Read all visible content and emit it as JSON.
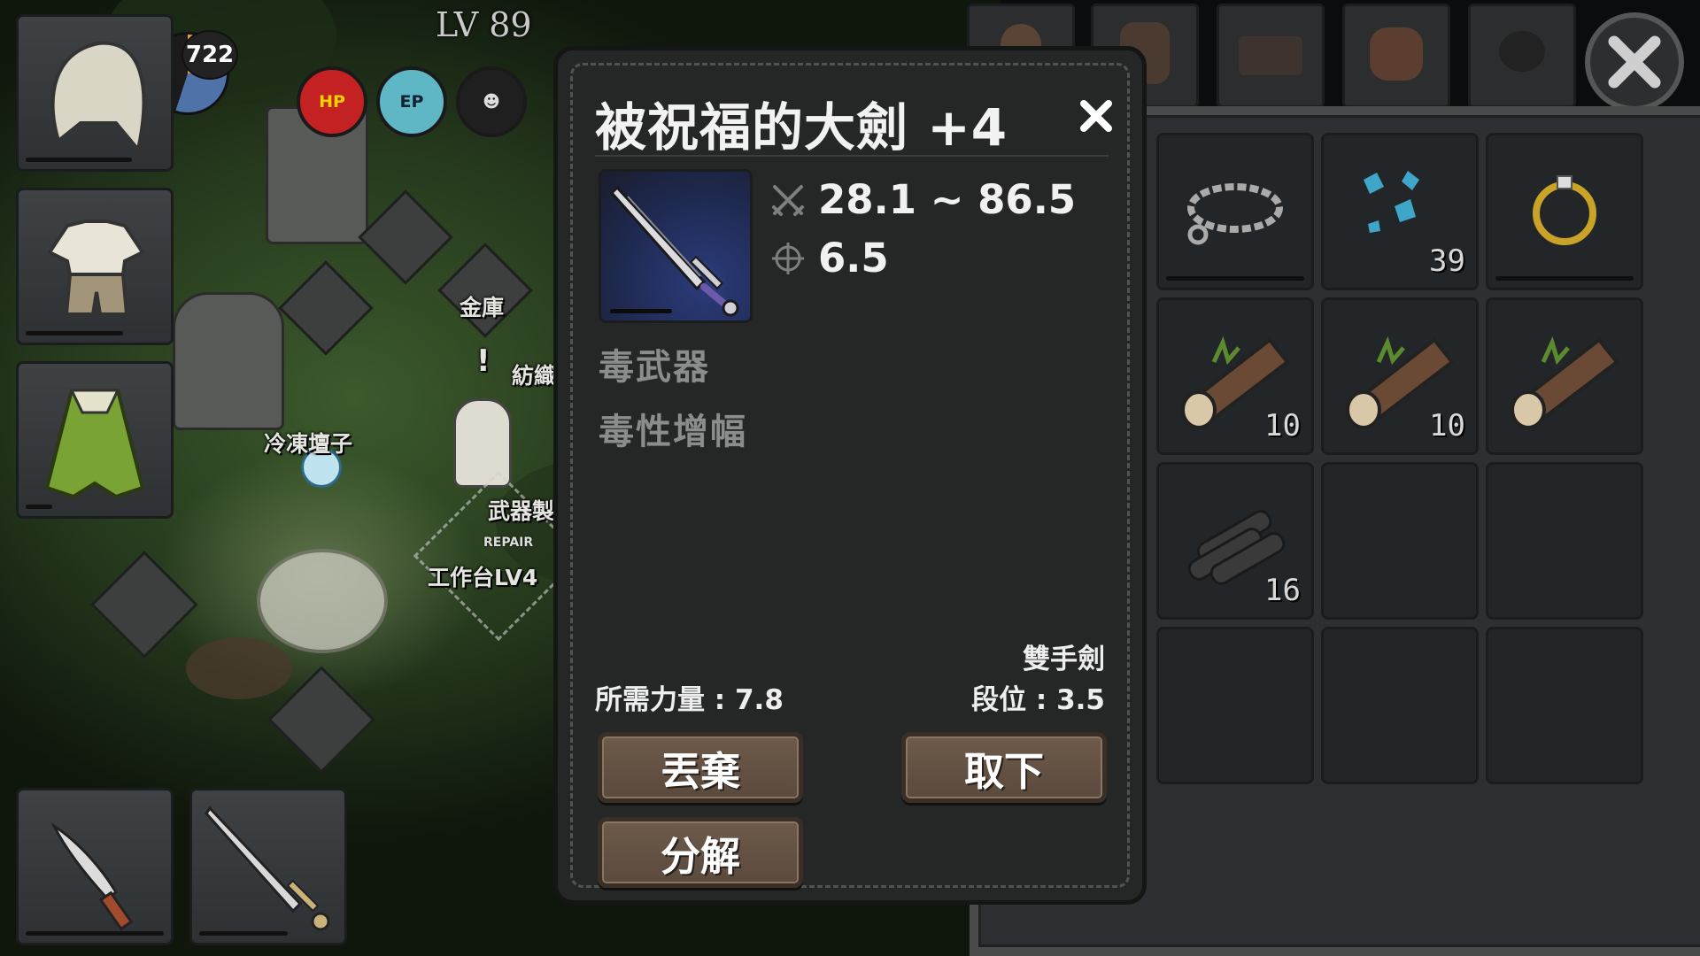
{
  "hud": {
    "level": "LV 89",
    "clock_value": "722",
    "hp_label": "HP",
    "ep_label": "EP"
  },
  "world": {
    "labels": [
      "金庫",
      "冷凍壇子",
      "武器製",
      "工作台LV4",
      "紡織"
    ],
    "repair_text": "REPAIR",
    "alert": "!"
  },
  "equipment": {
    "slots": [
      "hood-icon",
      "shirt-icon",
      "cape-icon",
      "knife-icon",
      "greatsword-icon"
    ]
  },
  "inventory": {
    "tabs": [
      "pouch-icon",
      "backpack-icon",
      "chest-icon",
      "bag-icon",
      "skull-icon"
    ],
    "items": [
      {
        "icon": "chain-necklace-icon",
        "qty": ""
      },
      {
        "icon": "crystal-shards-icon",
        "qty": "39"
      },
      {
        "icon": "gold-ring-icon",
        "qty": ""
      },
      {
        "icon": "log-icon",
        "qty": "10"
      },
      {
        "icon": "log-icon",
        "qty": "10"
      },
      {
        "icon": "log-icon",
        "qty": ""
      },
      {
        "icon": "firewood-icon",
        "qty": "16"
      }
    ]
  },
  "modal": {
    "title": "被祝福的大劍 +4",
    "damage": "28.1 ~ 86.5",
    "accuracy": "6.5",
    "traits": [
      "毒武器",
      "毒性增幅"
    ],
    "weapon_type": "雙手劍",
    "required_strength": "所需力量 : 7.8",
    "tier": "段位 : 3.5",
    "buttons": {
      "discard": "丟棄",
      "unequip": "取下",
      "disassemble": "分解"
    }
  },
  "colors": {
    "button_bg": "#6d5a4a",
    "modal_bg": "#252727",
    "trait_text": "#8b8d8c"
  }
}
